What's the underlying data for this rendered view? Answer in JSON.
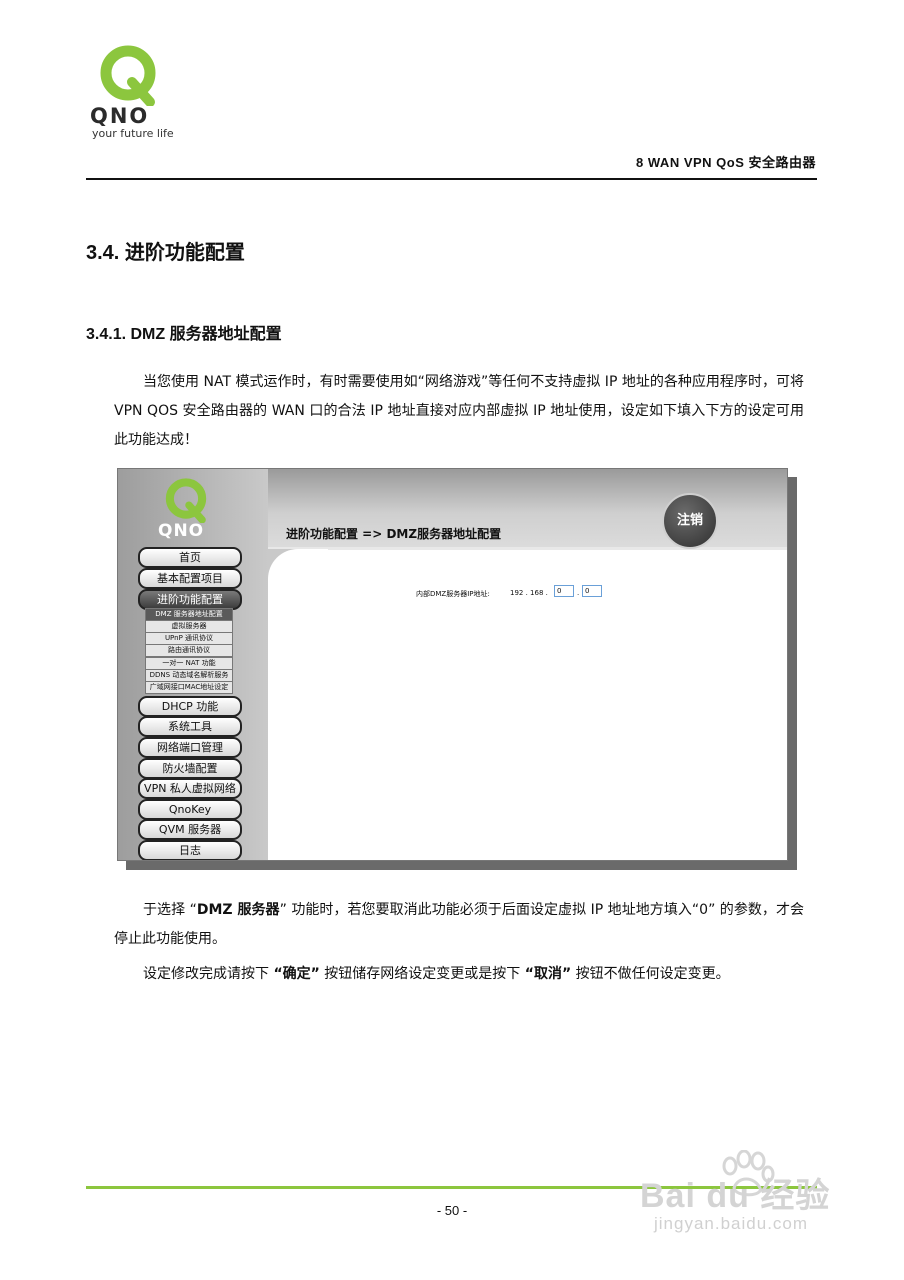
{
  "header": {
    "logo_word": "QNO",
    "logo_tagline": "your future life",
    "title": "8  WAN  VPN  QoS  安全路由器"
  },
  "section": {
    "heading": "3.4.  进阶功能配置",
    "subheading": "3.4.1. DMZ  服务器地址配置"
  },
  "paragraph1": "当您使用 NAT 模式运作时，有时需要使用如“网络游戏”等任何不支持虚拟 IP 地址的各种应用程序时，可将 VPN QOS 安全路由器的 WAN 口的合法 IP 地址直接对应内部虚拟 IP 地址使用，设定如下填入下方的设定可用此功能达成！",
  "screenshot": {
    "logo_word": "QNO",
    "logout_label": "注销",
    "page_title": "进阶功能配置  => DMZ服务器地址配置",
    "nav": [
      {
        "label": "首页"
      },
      {
        "label": "基本配置项目"
      },
      {
        "label": "进阶功能配置"
      },
      {
        "label": "DHCP 功能"
      },
      {
        "label": "系统工具"
      },
      {
        "label": "网络端口管理"
      },
      {
        "label": "防火墙配置"
      },
      {
        "label": "VPN 私人虚拟网络"
      },
      {
        "label": "QnoKey"
      },
      {
        "label": "QVM 服务器"
      },
      {
        "label": "日志"
      }
    ],
    "subnav": [
      {
        "label": "DMZ 服务器地址配置"
      },
      {
        "label": "虚拟服务器"
      },
      {
        "label": "UPnP 通讯协议"
      },
      {
        "label": "路由通讯协议"
      },
      {
        "label": "一对一 NAT 功能"
      },
      {
        "label": "DDNS 动态域名解析服务"
      },
      {
        "label": "广域网接口MAC地址设定"
      }
    ],
    "field_label": "内部DMZ服务器IP地址:",
    "ip_prefix": "192 . 168 .",
    "ip_octet3": "0",
    "ip_octet4": "0"
  },
  "paragraph2": {
    "before": "于选择 “",
    "bold": "DMZ  服务器",
    "after": "” 功能时，若您要取消此功能必须于后面设定虚拟 IP 地址地方填入“0” 的参数，才会停止此功能使用。"
  },
  "paragraph3": {
    "t1": "设定修改完成请按下 ",
    "b1": "“确定”",
    "t2": " 按钮储存网络设定变更或是按下 ",
    "b2": "“取消”",
    "t3": " 按钮不做任何设定变更。"
  },
  "footer": {
    "page_number": "- 50 -",
    "watermark_brand": "Bai du 经验",
    "watermark_url": "jingyan.baidu.com"
  },
  "colors": {
    "brand_green": "#8cc63e",
    "ui_gray": "#c9c9c9"
  }
}
